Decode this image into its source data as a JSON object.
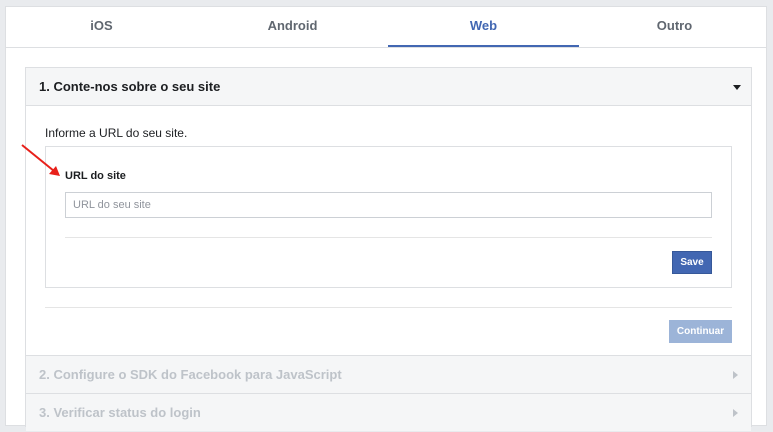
{
  "tabs": [
    {
      "label": "iOS",
      "active": false
    },
    {
      "label": "Android",
      "active": false
    },
    {
      "label": "Web",
      "active": true
    },
    {
      "label": "Outro",
      "active": false
    }
  ],
  "step1": {
    "title": "1. Conte-nos sobre o seu site",
    "intro": "Informe a URL do seu site.",
    "field_label": "URL do site",
    "input_value": "",
    "input_placeholder": "URL do seu site",
    "save_label": "Save",
    "continue_label": "Continuar"
  },
  "step2": {
    "title": "2. Configure o SDK do Facebook para JavaScript"
  },
  "step3": {
    "title": "3. Verificar status do login"
  },
  "colors": {
    "accent": "#4267b2",
    "annotation_arrow": "#e8201a",
    "disabled_button": "#9cb4d8"
  }
}
